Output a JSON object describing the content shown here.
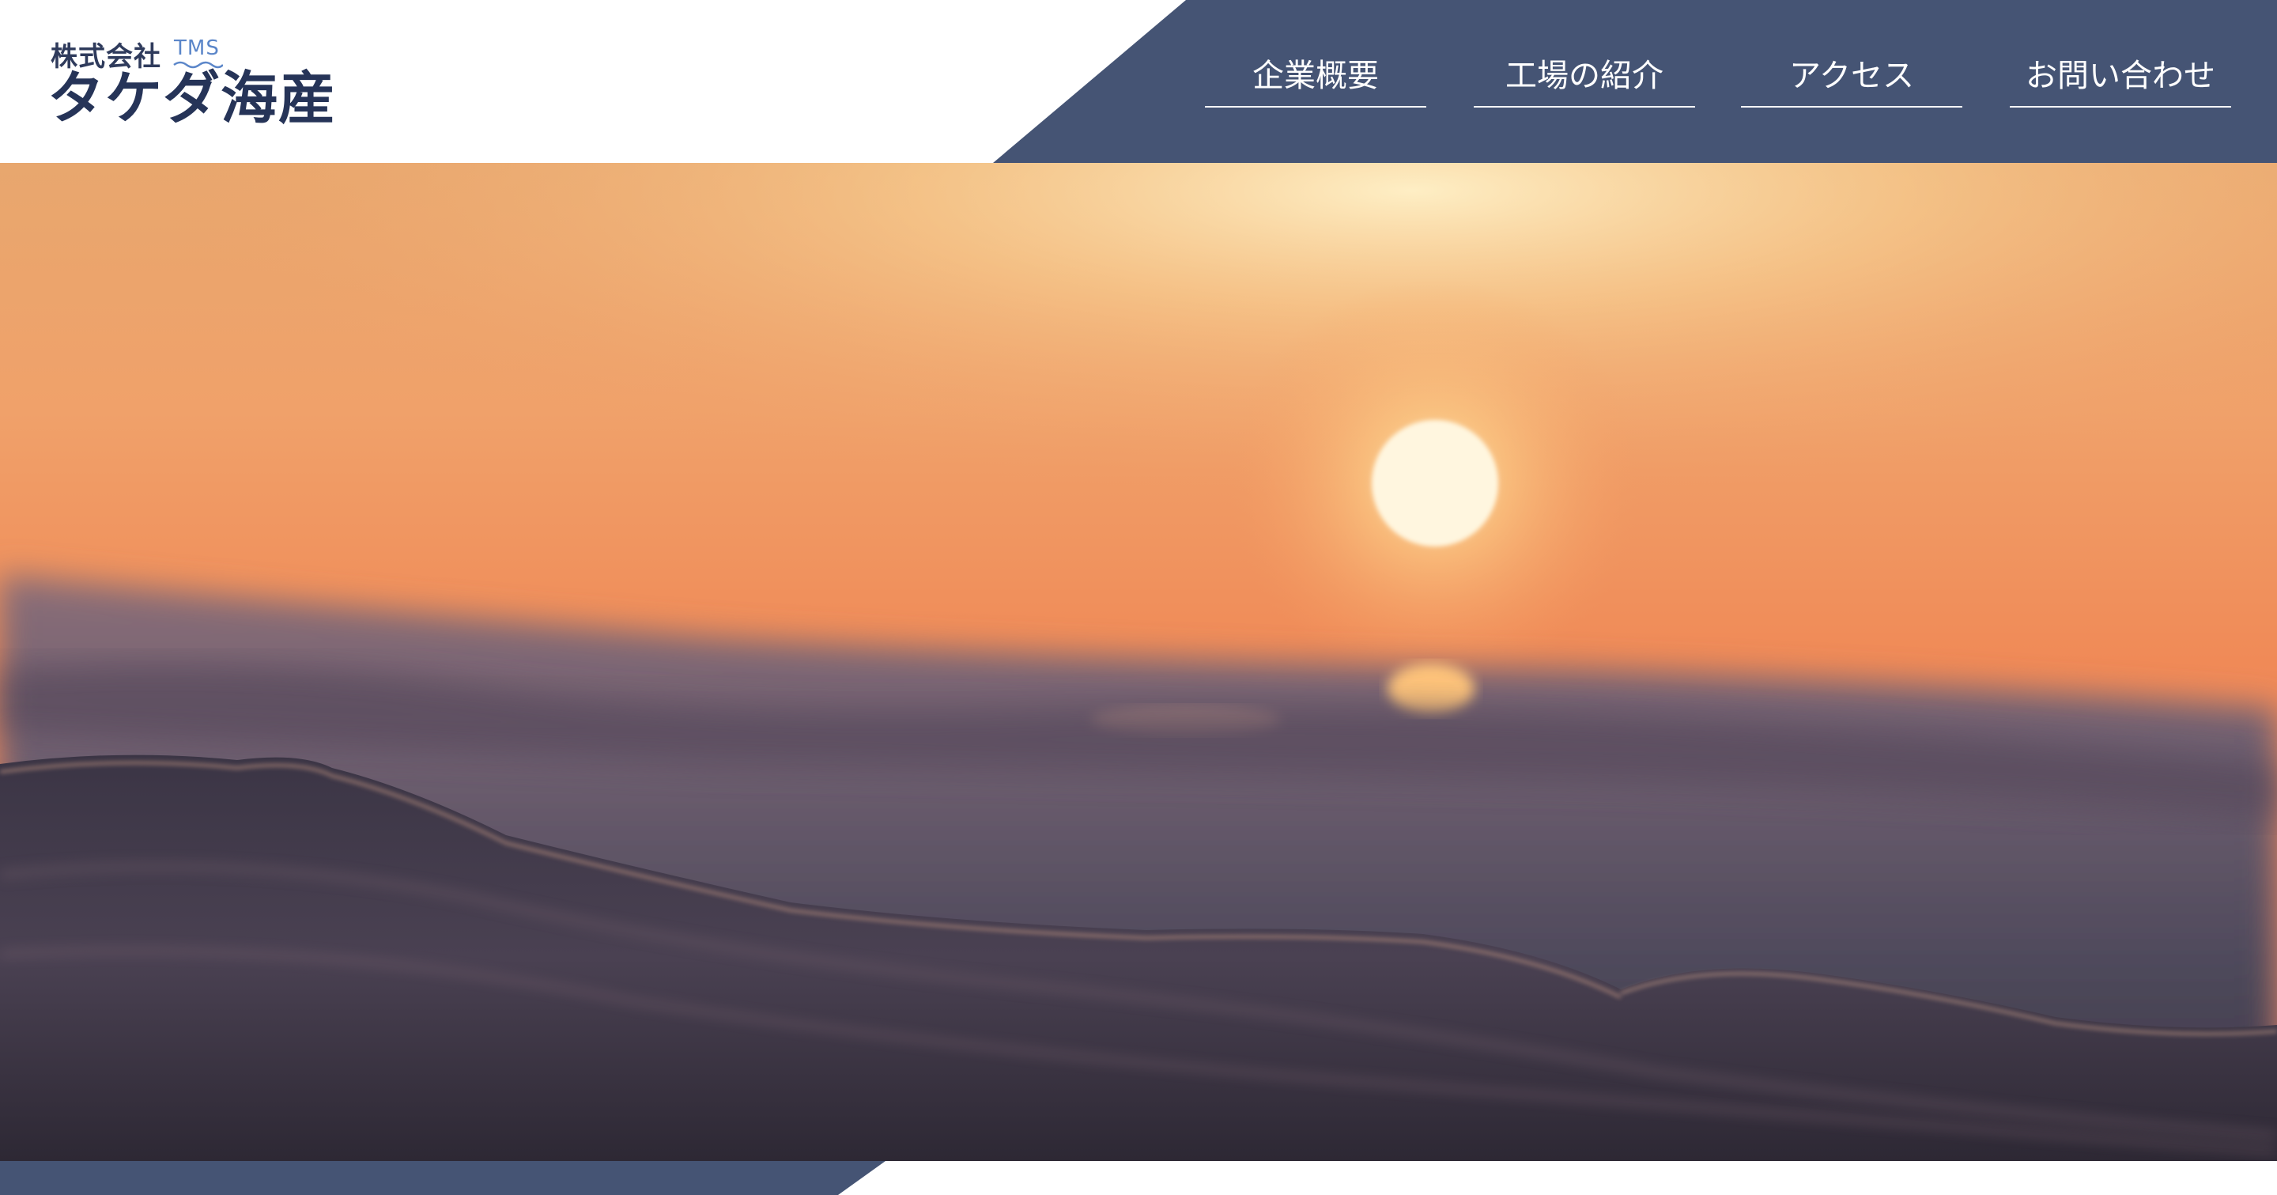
{
  "brand": {
    "company_prefix": "株式会社",
    "mark": "TMS",
    "name": "タケダ海産"
  },
  "nav": {
    "items": [
      {
        "label": "企業概要"
      },
      {
        "label": "工場の紹介"
      },
      {
        "label": "アクセス"
      },
      {
        "label": "お問い合わせ"
      }
    ]
  },
  "hero": {
    "image": "sunset-over-ocean-waves"
  },
  "colors": {
    "nav_bg": "#455474",
    "brand_text": "#263458",
    "mark_blue": "#5b86c9"
  }
}
